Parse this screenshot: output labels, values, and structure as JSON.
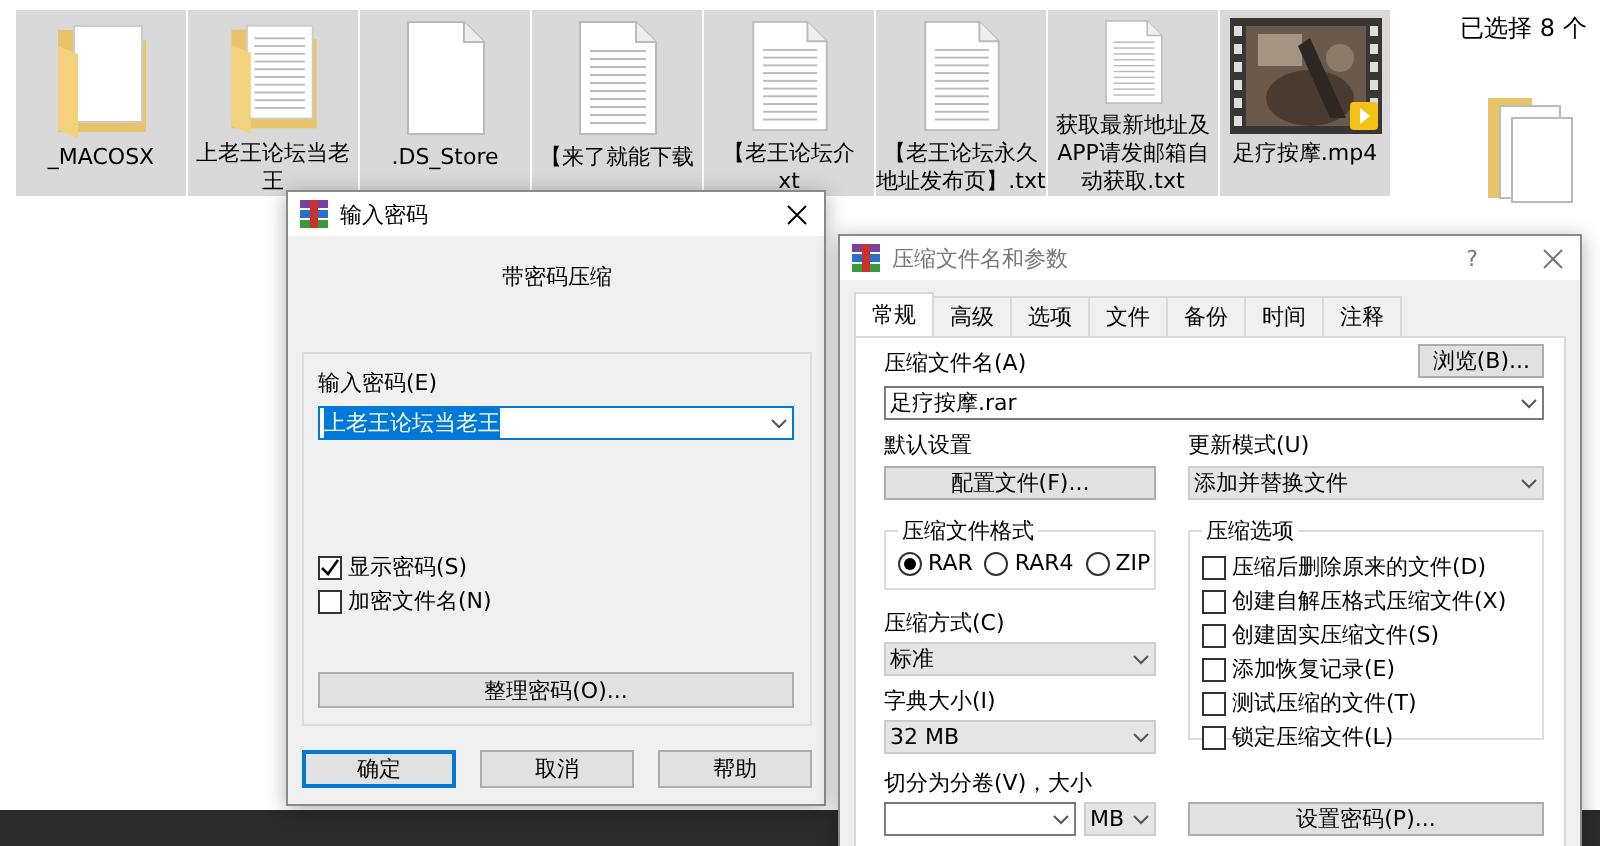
{
  "explorer": {
    "files": [
      {
        "kind": "folder",
        "lines": [
          "_MACOSX"
        ]
      },
      {
        "kind": "folder_docs",
        "lines": [
          "上老王论坛当老",
          "王"
        ]
      },
      {
        "kind": "blank",
        "lines": [
          ".DS_Store"
        ]
      },
      {
        "kind": "text",
        "lines": [
          "【来了就能下载"
        ]
      },
      {
        "kind": "text",
        "lines": [
          "【老王论坛介",
          "xt"
        ]
      },
      {
        "kind": "text",
        "lines": [
          "【老王论坛永久",
          "地址发布页】.txt"
        ]
      },
      {
        "kind": "text",
        "lines": [
          "获取最新地址及",
          "APP请发邮箱自",
          "动获取.txt"
        ]
      },
      {
        "kind": "video",
        "lines": [
          "足疗按摩.mp4"
        ]
      }
    ],
    "selection_info": "已选择 8 个"
  },
  "password_dialog": {
    "title": "输入密码",
    "heading": "带密码压缩",
    "password_label": "输入密码(E)",
    "password_value": "上老王论坛当老王",
    "value_selected": true,
    "options": [
      {
        "label": "显示密码(S)",
        "checked": true
      },
      {
        "label": "加密文件名(N)",
        "checked": false
      }
    ],
    "organize_button": "整理密码(O)...",
    "buttons": [
      {
        "label": "确定",
        "default": true
      },
      {
        "label": "取消",
        "default": false
      },
      {
        "label": "帮助",
        "default": false
      }
    ]
  },
  "archive_dialog": {
    "title": "压缩文件名和参数",
    "help": "?",
    "tabs": [
      {
        "label": "常规",
        "selected": true
      },
      {
        "label": "高级",
        "selected": false
      },
      {
        "label": "选项",
        "selected": false
      },
      {
        "label": "文件",
        "selected": false
      },
      {
        "label": "备份",
        "selected": false
      },
      {
        "label": "时间",
        "selected": false
      },
      {
        "label": "注释",
        "selected": false
      }
    ],
    "archive_name_label": "压缩文件名(A)",
    "browse_button": "浏览(B)...",
    "archive_name": "足疗按摩.rar",
    "profile_label": "默认设置",
    "profile_button": "配置文件(F)...",
    "update_mode_label": "更新模式(U)",
    "update_mode": "添加并替换文件",
    "format_group": "压缩文件格式",
    "formats": [
      {
        "label": "RAR",
        "selected": true
      },
      {
        "label": "RAR4",
        "selected": false
      },
      {
        "label": "ZIP",
        "selected": false
      }
    ],
    "method_label": "压缩方式(C)",
    "method": "标准",
    "dictionary_label": "字典大小(I)",
    "dictionary": "32 MB",
    "split_label": "切分为分卷(V)，大小",
    "split_unit": "MB",
    "options_group": "压缩选项",
    "options": [
      {
        "label": "压缩后删除原来的文件(D)",
        "checked": false
      },
      {
        "label": "创建自解压格式压缩文件(X)",
        "checked": false
      },
      {
        "label": "创建固实压缩文件(S)",
        "checked": false
      },
      {
        "label": "添加恢复记录(E)",
        "checked": false
      },
      {
        "label": "测试压缩的文件(T)",
        "checked": false
      },
      {
        "label": "锁定压缩文件(L)",
        "checked": false
      }
    ],
    "password_button": "设置密码(P)..."
  }
}
